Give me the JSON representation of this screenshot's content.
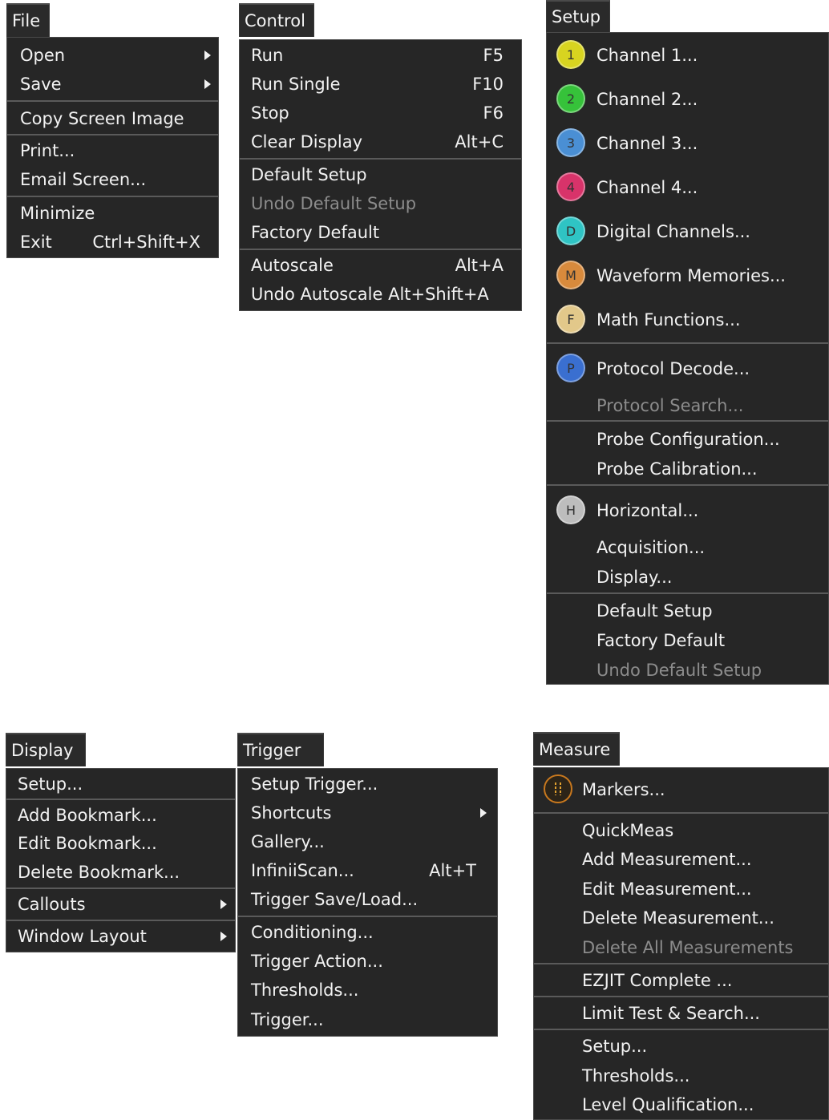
{
  "file_menu": {
    "title": "File",
    "items": [
      {
        "label": "Open",
        "submenu": true
      },
      {
        "label": "Save",
        "submenu": true
      },
      {
        "label": "Copy Screen Image"
      },
      {
        "label": "Print..."
      },
      {
        "label": "Email Screen..."
      },
      {
        "label": "Minimize"
      },
      {
        "label": "Exit",
        "shortcut": "Ctrl+Shift+X"
      }
    ]
  },
  "control_menu": {
    "title": "Control",
    "items": [
      {
        "label": "Run",
        "shortcut": "F5"
      },
      {
        "label": "Run Single",
        "shortcut": "F10"
      },
      {
        "label": "Stop",
        "shortcut": "F6"
      },
      {
        "label": "Clear Display",
        "shortcut": "Alt+C"
      },
      {
        "label": "Default Setup"
      },
      {
        "label": "Undo Default Setup",
        "disabled": true
      },
      {
        "label": "Factory Default"
      },
      {
        "label": "Autoscale",
        "shortcut": "Alt+A"
      },
      {
        "label": "Undo Autoscale Alt+Shift+A"
      }
    ]
  },
  "setup_menu": {
    "title": "Setup",
    "items": [
      {
        "label": "Channel 1...",
        "icon": "channel-1-icon",
        "icon_text": "1",
        "icon_color": "#d8d420"
      },
      {
        "label": "Channel 2...",
        "icon": "channel-2-icon",
        "icon_text": "2",
        "icon_color": "#36c23a"
      },
      {
        "label": "Channel 3...",
        "icon": "channel-3-icon",
        "icon_text": "3",
        "icon_color": "#4a8fd4"
      },
      {
        "label": "Channel 4...",
        "icon": "channel-4-icon",
        "icon_text": "4",
        "icon_color": "#d8336a"
      },
      {
        "label": "Digital Channels...",
        "icon": "digital-channels-icon",
        "icon_text": "D",
        "icon_color": "#2fc4c4"
      },
      {
        "label": "Waveform Memories...",
        "icon": "waveform-memories-icon",
        "icon_text": "M",
        "icon_color": "#d88a3c"
      },
      {
        "label": "Math Functions...",
        "icon": "math-functions-icon",
        "icon_text": "F",
        "icon_color": "#e2c88a"
      },
      {
        "label": "Protocol Decode...",
        "icon": "protocol-decode-icon",
        "icon_text": "P",
        "icon_color": "#3a6fd0"
      },
      {
        "label": "Protocol Search...",
        "disabled": true
      },
      {
        "label": "Probe Configuration..."
      },
      {
        "label": "Probe Calibration..."
      },
      {
        "label": "Horizontal...",
        "icon": "horizontal-icon",
        "icon_text": "H",
        "icon_color": "#bdbdbd"
      },
      {
        "label": "Acquisition..."
      },
      {
        "label": "Display..."
      },
      {
        "label": "Default Setup"
      },
      {
        "label": "Factory Default"
      },
      {
        "label": "Undo Default Setup",
        "disabled": true
      }
    ]
  },
  "display_menu": {
    "title": "Display",
    "items": [
      {
        "label": "Setup..."
      },
      {
        "label": "Add Bookmark..."
      },
      {
        "label": "Edit Bookmark..."
      },
      {
        "label": "Delete Bookmark..."
      },
      {
        "label": "Callouts",
        "submenu": true
      },
      {
        "label": "Window Layout",
        "submenu": true
      }
    ]
  },
  "trigger_menu": {
    "title": "Trigger",
    "items": [
      {
        "label": "Setup Trigger..."
      },
      {
        "label": "Shortcuts",
        "submenu": true
      },
      {
        "label": "Gallery..."
      },
      {
        "label": "InfiniiScan...",
        "shortcut": "Alt+T"
      },
      {
        "label": "Trigger Save/Load..."
      },
      {
        "label": "Conditioning..."
      },
      {
        "label": "Trigger Action..."
      },
      {
        "label": "Thresholds..."
      },
      {
        "label": "Trigger..."
      }
    ]
  },
  "measure_menu": {
    "title": "Measure",
    "items": [
      {
        "label": "Markers...",
        "icon": "markers-icon",
        "icon_color": "#c8781e"
      },
      {
        "label": "QuickMeas"
      },
      {
        "label": "Add Measurement..."
      },
      {
        "label": "Edit Measurement..."
      },
      {
        "label": "Delete Measurement..."
      },
      {
        "label": "Delete All Measurements",
        "disabled": true
      },
      {
        "label": "EZJIT Complete ..."
      },
      {
        "label": "Limit Test & Search..."
      },
      {
        "label": "Setup..."
      },
      {
        "label": "Thresholds..."
      },
      {
        "label": "Level Qualification..."
      }
    ]
  }
}
